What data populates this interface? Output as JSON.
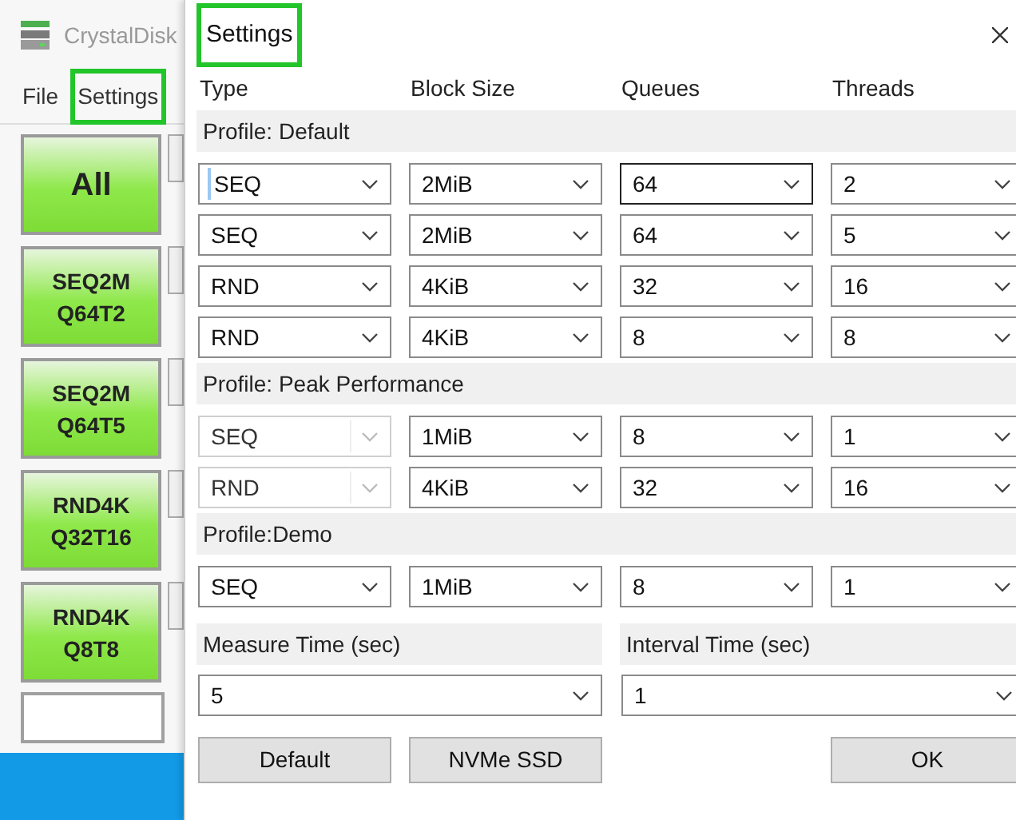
{
  "main_window": {
    "title": "CrystalDisk",
    "menu": [
      {
        "label": "File",
        "highlighted": false
      },
      {
        "label": "Settings",
        "highlighted": true
      }
    ],
    "test_buttons": [
      {
        "lines": [
          "All"
        ]
      },
      {
        "lines": [
          "SEQ2M",
          "Q64T2"
        ]
      },
      {
        "lines": [
          "SEQ2M",
          "Q64T5"
        ]
      },
      {
        "lines": [
          "RND4K",
          "Q32T16"
        ]
      },
      {
        "lines": [
          "RND4K",
          "Q8T8"
        ]
      }
    ]
  },
  "dialog": {
    "title": "Settings",
    "title_highlighted": true,
    "columns": [
      "Type",
      "Block Size",
      "Queues",
      "Threads"
    ],
    "profiles": [
      {
        "label": "Profile: Default",
        "rows": [
          [
            {
              "value": "SEQ",
              "disabled": false,
              "focused": false,
              "caret": true
            },
            {
              "value": "2MiB",
              "disabled": false,
              "focused": false,
              "caret": false
            },
            {
              "value": "64",
              "disabled": false,
              "focused": true,
              "caret": false
            },
            {
              "value": "2",
              "disabled": false,
              "focused": false,
              "caret": false
            }
          ],
          [
            {
              "value": "SEQ",
              "disabled": false,
              "focused": false,
              "caret": false
            },
            {
              "value": "2MiB",
              "disabled": false,
              "focused": false,
              "caret": false
            },
            {
              "value": "64",
              "disabled": false,
              "focused": false,
              "caret": false
            },
            {
              "value": "5",
              "disabled": false,
              "focused": false,
              "caret": false
            }
          ],
          [
            {
              "value": "RND",
              "disabled": false,
              "focused": false,
              "caret": false
            },
            {
              "value": "4KiB",
              "disabled": false,
              "focused": false,
              "caret": false
            },
            {
              "value": "32",
              "disabled": false,
              "focused": false,
              "caret": false
            },
            {
              "value": "16",
              "disabled": false,
              "focused": false,
              "caret": false
            }
          ],
          [
            {
              "value": "RND",
              "disabled": false,
              "focused": false,
              "caret": false
            },
            {
              "value": "4KiB",
              "disabled": false,
              "focused": false,
              "caret": false
            },
            {
              "value": "8",
              "disabled": false,
              "focused": false,
              "caret": false
            },
            {
              "value": "8",
              "disabled": false,
              "focused": false,
              "caret": false
            }
          ]
        ]
      },
      {
        "label": "Profile: Peak Performance",
        "rows": [
          [
            {
              "value": "SEQ",
              "disabled": true,
              "focused": false,
              "caret": false
            },
            {
              "value": "1MiB",
              "disabled": false,
              "focused": false,
              "caret": false
            },
            {
              "value": "8",
              "disabled": false,
              "focused": false,
              "caret": false
            },
            {
              "value": "1",
              "disabled": false,
              "focused": false,
              "caret": false
            }
          ],
          [
            {
              "value": "RND",
              "disabled": true,
              "focused": false,
              "caret": false
            },
            {
              "value": "4KiB",
              "disabled": false,
              "focused": false,
              "caret": false
            },
            {
              "value": "32",
              "disabled": false,
              "focused": false,
              "caret": false
            },
            {
              "value": "16",
              "disabled": false,
              "focused": false,
              "caret": false
            }
          ]
        ]
      },
      {
        "label": "Profile:Demo",
        "rows": [
          [
            {
              "value": "SEQ",
              "disabled": false,
              "focused": false,
              "caret": false
            },
            {
              "value": "1MiB",
              "disabled": false,
              "focused": false,
              "caret": false
            },
            {
              "value": "8",
              "disabled": false,
              "focused": false,
              "caret": false
            },
            {
              "value": "1",
              "disabled": false,
              "focused": false,
              "caret": false
            }
          ]
        ]
      }
    ],
    "measure_time": {
      "label": "Measure Time (sec)",
      "value": "5"
    },
    "interval_time": {
      "label": "Interval Time (sec)",
      "value": "1"
    },
    "buttons": [
      {
        "label": "Default",
        "kind": "left"
      },
      {
        "label": "NVMe SSD",
        "kind": "left"
      },
      {
        "label": "OK",
        "kind": "right"
      }
    ]
  }
}
